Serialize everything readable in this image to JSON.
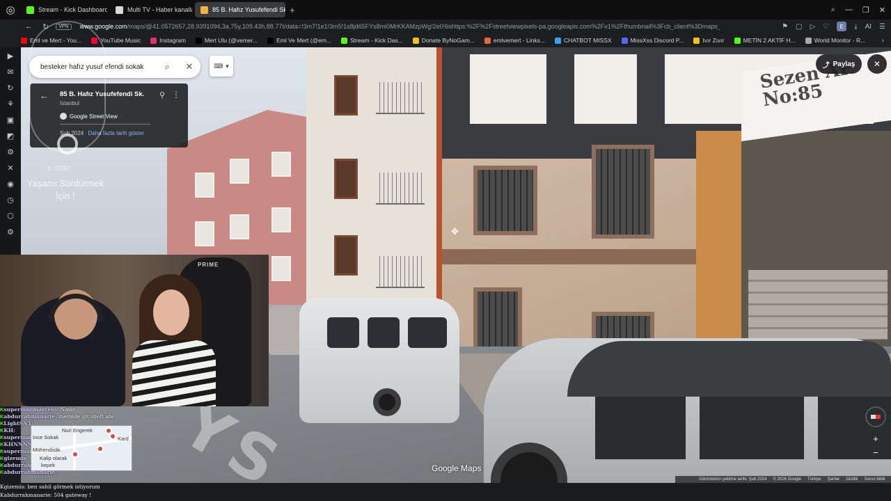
{
  "browser": {
    "tabs": [
      {
        "label": "Stream - Kick Dashboard",
        "color": "#53fc18",
        "active": false
      },
      {
        "label": "Multi TV - Haber kanalları",
        "color": "#d9d9d9",
        "active": false
      },
      {
        "label": "85 B. Hafız Yusufefendi Sk",
        "color": "#f2b33d",
        "active": true
      }
    ],
    "new_tab_icon": "plus-icon",
    "url_host": "www.google.com",
    "url_rest": "/maps/@41.0572657,28.9391094,3a,75y,109.43h,88.77t/data=!3m7!1e1!3m5!1s8jd65FYs8mi0MrKKAMzpWg!2e0!6shttps:%2F%2Fstreetviewpixels-pa.googleapis.com%2Fv1%2Fthumbnail%3Fcb_client%3Dmaps_s",
    "vpn_label": "VPN",
    "bookmarks": [
      {
        "label": "Eml ve Mert - You...",
        "color": "#ff0000"
      },
      {
        "label": "YouTube Music",
        "color": "#ff0033"
      },
      {
        "label": "Instagram",
        "color": "#e1306c"
      },
      {
        "label": "Mert Ulu (@vemer...",
        "color": "#000000"
      },
      {
        "label": "Eml Ve Mert (@em...",
        "color": "#000000"
      },
      {
        "label": "Stream - Kick Das...",
        "color": "#53fc18"
      },
      {
        "label": "Donate ByNoGam...",
        "color": "#f0c419"
      },
      {
        "label": "emlvemert - Links...",
        "color": "#e06a3a"
      },
      {
        "label": "CHATBOT MISSX",
        "color": "#3aa0f0"
      },
      {
        "label": "MissXss Discord P...",
        "color": "#5865f2"
      },
      {
        "label": "Ivır Zıvır",
        "color": "#f0c419"
      },
      {
        "label": "METİN 2 AKTİF H...",
        "color": "#53fc18"
      },
      {
        "label": "World Monitor - R...",
        "color": "#aaaaaa"
      }
    ],
    "profile_initial": "E",
    "ai_label": "AI"
  },
  "streetview": {
    "search_query": "besteker hafız yusuf efendi sokak",
    "card": {
      "title": "85 B. Hafız Yusufefendi Sk.",
      "subtitle": "İstanbul",
      "brand": "Google Street View",
      "date": "Şub 2024",
      "more_dates": "Daha fazla tarih göster"
    },
    "share_label": "Paylaş",
    "sign_text": "Sezen AP\nNo:85",
    "road_text": "YS",
    "brand_label": "Google Maps",
    "footer": [
      "Görüntünün çekilme tarihi: Şub 2024",
      "© 2026 Google",
      "Türkiye",
      "Şartlar",
      "Gizlilik",
      "Sorun bildir"
    ],
    "zoom_in": "+",
    "zoom_out": "−"
  },
  "stream_overlay": {
    "year": "Y. 2030'",
    "text": "Yaşamı Sürdürmek\nİçin !",
    "chair_brand": "PRIME"
  },
  "chat": {
    "lines": [
      {
        "user": "supermanmarcelo",
        "msg": "Nasır"
      },
      {
        "user": "abdurrahmanarie",
        "msg": "merside git sheft abi"
      },
      {
        "user": "LightSNT",
        "msg": ""
      },
      {
        "user": "KH",
        "msg": ""
      },
      {
        "user": "supermanmarcelo",
        "msg": ""
      },
      {
        "user": "KHNNNN",
        "msg": ""
      },
      {
        "user": "supermanmarcelo",
        "msg": ""
      },
      {
        "user": "gizemis",
        "msg": ""
      },
      {
        "user": "abdurrahmanarie",
        "msg": "setprin suzgunum"
      },
      {
        "user": "abdurrahmanarie",
        "msg": ""
      }
    ],
    "bottom_lines": [
      {
        "user": "gizemis",
        "msg": "ben sahil görmek istiyorum"
      },
      {
        "user": "abdurrahmanarie",
        "msg": "504 gateway !"
      }
    ]
  },
  "minimap": {
    "labels": [
      "Nuri Engerek",
      "Ince Sokak",
      "Kard",
      "Mühendislik",
      "Kalip olarak",
      "kepek"
    ]
  }
}
